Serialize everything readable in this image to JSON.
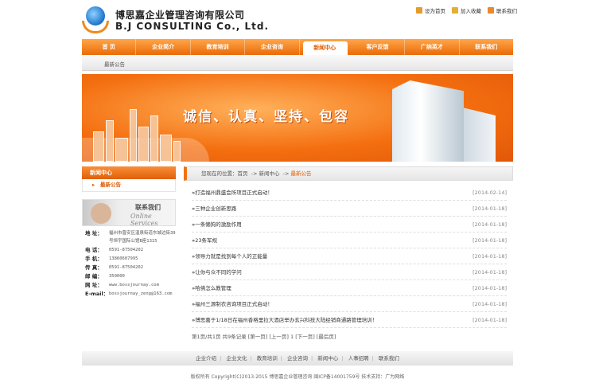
{
  "header": {
    "cn_name": "博思嘉企业管理咨询有限公司",
    "en_name": "B.J CONSULTING Co., Ltd.",
    "toplinks": [
      {
        "label": "设为首页",
        "icon": "home-icon",
        "color": "#e59b2e"
      },
      {
        "label": "加入收藏",
        "icon": "favorite-icon",
        "color": "#e5b02e"
      },
      {
        "label": "联系我们",
        "icon": "mail-icon",
        "color": "#e58a2e"
      }
    ]
  },
  "nav": {
    "items": [
      "首  页",
      "企业简介",
      "教育培训",
      "企业咨询",
      "新闻中心",
      "客户反馈",
      "广纳英才",
      "联系我们"
    ],
    "active": "新闻中心"
  },
  "subnav": {
    "label": "最新公告"
  },
  "banner": {
    "slogan": "诚信、认真、坚持、包容"
  },
  "sidebar": {
    "title": "新闻中心",
    "menu_item": "最新公告",
    "contact_title": "联系我们",
    "contact_subtitle": "Online Services",
    "contacts": [
      {
        "label": "地  址：",
        "value": "福州市晋安区温泉街道东城边街39号恒宇国际公馆B座1315"
      },
      {
        "label": "电  话：",
        "value": "0591-87504202"
      },
      {
        "label": "手  机：",
        "value": "13860607995"
      },
      {
        "label": "传  真：",
        "value": "0591-87504202"
      },
      {
        "label": "邮  编：",
        "value": "350000"
      },
      {
        "label": "网  址：",
        "value": "www.bossjournay.com"
      },
      {
        "label": "E-mail：",
        "value": "bossjournay_zeng@163.com"
      }
    ]
  },
  "breadcrumb": {
    "prefix": "您现在的位置：",
    "home": "首页",
    "section": "新闻中心",
    "current": "最新公告"
  },
  "news": [
    {
      "title": "打造福州鼎盛会所项目正式启动！",
      "date": "[2014-02-14]"
    },
    {
      "title": "三种企业创新思路",
      "date": "[2014-01-18]"
    },
    {
      "title": "一条懒狗的激励作用",
      "date": "[2014-01-18]"
    },
    {
      "title": "23条军规",
      "date": "[2014-01-18]"
    },
    {
      "title": "领导力就是找到每个人的正能量",
      "date": "[2014-01-18]"
    },
    {
      "title": "让你与众不同的学问",
      "date": "[2014-01-18]"
    },
    {
      "title": "哈佛怎么教管理",
      "date": "[2014-01-18]"
    },
    {
      "title": "福州三源制衣咨询项目正式启动！",
      "date": "[2014-01-18]"
    },
    {
      "title": "博思嘉于1/18日在福州香格里拉大酒店举办玄兴科技大陆经销商通路管理培训！",
      "date": "[2014-01-18]"
    }
  ],
  "pager": {
    "text": "第1页/共1页     共9条记录 [第一页] [上一页] 1 [下一页] [最后页]"
  },
  "footer": {
    "links": [
      "企业介绍",
      "企业文化",
      "教育培训",
      "企业咨询",
      "新闻中心",
      "人事招聘",
      "联系我们"
    ],
    "copyright": "版权所有 Copyright(C)2013-2015 博思嘉企业管理咨询 闽ICP备14001759号  技术支持：广为网络"
  }
}
